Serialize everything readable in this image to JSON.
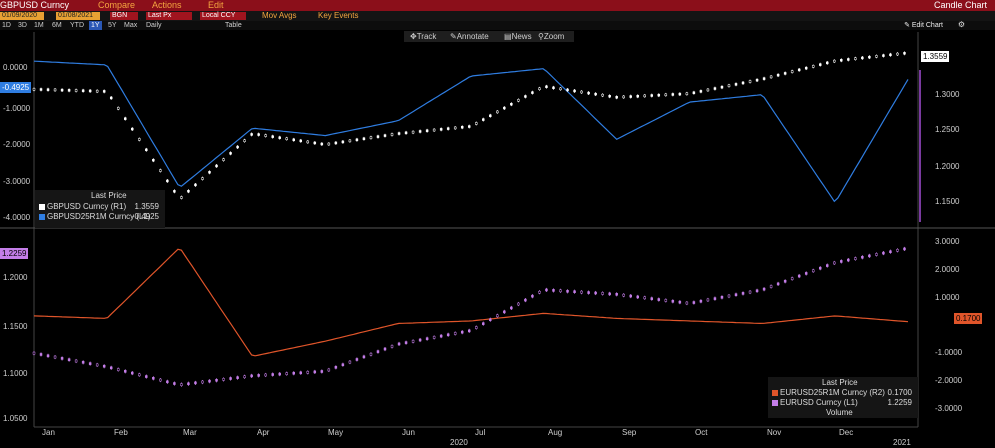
{
  "topbar": {
    "security": "GBPUSD Curncy",
    "menu": [
      "Compare",
      "Actions",
      "Edit"
    ],
    "right_title": "Candle Chart"
  },
  "toolbar": {
    "start_date": "01/09/2020",
    "end_date": "01/08/2021",
    "source": "BGN",
    "field_type": "Last Px",
    "currency": "Local CCY",
    "options": [
      "Mov Avgs",
      "Key Events"
    ]
  },
  "ranges": [
    "1D",
    "3D",
    "1M",
    "6M",
    "YTD",
    "1Y",
    "5Y",
    "Max"
  ],
  "selected_range": "1Y",
  "frequency": "Daily",
  "view": "Table",
  "edit_chart": "Edit Chart",
  "tools": [
    "Track",
    "Annotate",
    "News",
    "Zoom"
  ],
  "upper": {
    "left_axis": [
      "0.0000",
      "-1.0000",
      "-2.0000",
      "-3.0000",
      "-4.0000"
    ],
    "right_axis": [
      "1.3000",
      "1.2500",
      "1.2000",
      "1.1500"
    ],
    "tag_right": "1.3559",
    "tag_left": "-0.4925",
    "legend": {
      "title": "Last Price",
      "rows": [
        {
          "label": "GBPUSD Curncy  (R1)",
          "value": "1.3559",
          "color": "#ffffff"
        },
        {
          "label": "GBPUSD25R1M Curncy  (L1)",
          "value": "-0.4925",
          "color": "#2f7de1"
        }
      ]
    }
  },
  "lower": {
    "left_axis": [
      "1.2000",
      "1.1500",
      "1.1000",
      "1.0500"
    ],
    "right_axis": [
      "3.0000",
      "2.0000",
      "1.0000",
      "-1.0000",
      "-2.0000",
      "-3.0000"
    ],
    "tag_left": "1.2259",
    "tag_right": "0.1700",
    "legend": {
      "title": "Last Price",
      "rows": [
        {
          "label": "EURUSD25R1M Curncy  (R2)",
          "value": "0.1700",
          "color": "#e0552a"
        },
        {
          "label": "EURUSD Curncy  (L1)",
          "value": "1.2259",
          "color": "#c47ee8"
        }
      ],
      "footer": "Volume"
    }
  },
  "months": [
    "Jan",
    "Feb",
    "Mar",
    "Apr",
    "May",
    "Jun",
    "Jul",
    "Aug",
    "Sep",
    "Oct",
    "Nov",
    "Dec"
  ],
  "year_labels": [
    "2020",
    "2021"
  ],
  "colors": {
    "gbp_candle": "#ffffff",
    "gbp_rr": "#2f7de1",
    "eur_candle": "#c47ee8",
    "eur_rr": "#e0552a",
    "title_bar": "#8b0f1a",
    "accent": "#f4a640"
  },
  "chart_data": [
    {
      "type": "line",
      "title": "",
      "x": [
        "Jan",
        "Feb",
        "Mar",
        "Apr",
        "May",
        "Jun",
        "Jul",
        "Aug",
        "Sep",
        "Oct",
        "Nov",
        "Dec",
        "2021"
      ],
      "series": [
        {
          "name": "GBPUSD Curncy",
          "axis": "right",
          "values": [
            1.306,
            1.303,
            1.155,
            1.245,
            1.23,
            1.245,
            1.255,
            1.31,
            1.295,
            1.3,
            1.32,
            1.345,
            1.356
          ]
        },
        {
          "name": "GBPUSD25R1M Curncy",
          "axis": "left",
          "values": [
            0.0,
            -0.1,
            -3.4,
            -1.8,
            -2.0,
            -1.6,
            -0.4,
            -0.2,
            -2.1,
            -1.1,
            -0.9,
            -3.8,
            -0.49
          ]
        }
      ],
      "left_ylim": [
        -4.0,
        0.3
      ],
      "right_ylim": [
        1.14,
        1.36
      ]
    },
    {
      "type": "line",
      "title": "",
      "x": [
        "Jan",
        "Feb",
        "Mar",
        "Apr",
        "May",
        "Jun",
        "Jul",
        "Aug",
        "Sep",
        "Oct",
        "Nov",
        "Dec",
        "2021"
      ],
      "series": [
        {
          "name": "EURUSD Curncy",
          "axis": "left",
          "values": [
            1.11,
            1.095,
            1.075,
            1.085,
            1.09,
            1.12,
            1.135,
            1.18,
            1.175,
            1.165,
            1.18,
            1.21,
            1.2259
          ]
        },
        {
          "name": "EURUSD25R1M Curncy",
          "axis": "right",
          "values": [
            0.4,
            0.3,
            3.1,
            -1.2,
            -0.6,
            0.1,
            0.2,
            0.5,
            0.3,
            0.2,
            0.1,
            0.4,
            0.17
          ]
        }
      ],
      "left_ylim": [
        1.045,
        1.235
      ],
      "right_ylim": [
        -3.4,
        3.4
      ]
    }
  ]
}
